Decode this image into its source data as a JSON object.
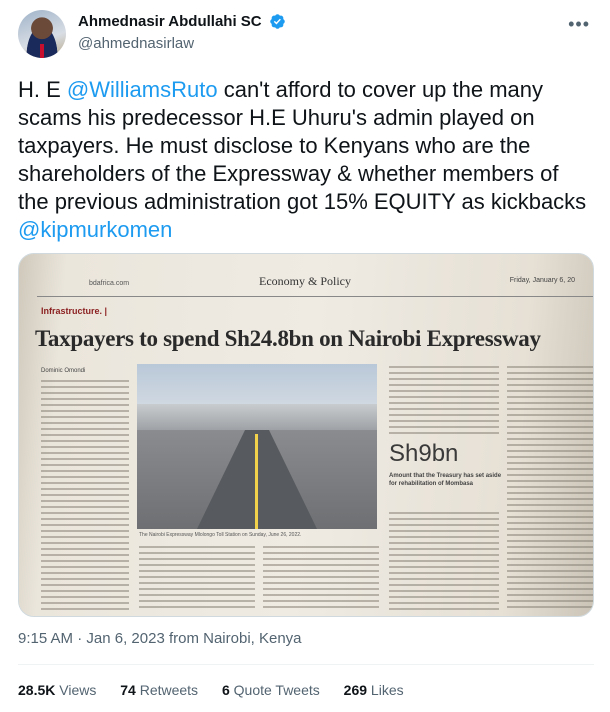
{
  "author": {
    "display_name": "Ahmednasir Abdullahi SC",
    "handle": "@ahmednasirlaw",
    "verified": true,
    "verified_color": "#1d9bf0"
  },
  "tweet": {
    "segments": [
      {
        "text": "H. E ",
        "type": "text"
      },
      {
        "text": "@WilliamsRuto",
        "type": "mention"
      },
      {
        "text": " can't afford to cover up the many scams his predecessor H.E Uhuru's admin played on taxpayers. He must disclose to Kenyans who are the shareholders of the Expressway & whether members of the previous administration got 15% EQUITY as kickbacks ",
        "type": "text"
      },
      {
        "text": "@kipmurkomen",
        "type": "mention"
      }
    ]
  },
  "media": {
    "site": "bdafrica.com",
    "section": "Economy & Policy",
    "date": "Friday, January 6, 20",
    "kicker": "Infrastructure. |",
    "headline": "Taxpayers to spend Sh24.8bn on Nairobi Expressway",
    "byline": "Dominic Omondi",
    "photo_caption": "The Nairobi Expressway Mlolongo Toll Station on Sunday, June 26, 2022.",
    "pull_figure": "Sh9bn",
    "pull_description": "Amount that the Treasury has set aside for rehabilitation of Mombasa"
  },
  "meta": {
    "time": "9:15 AM",
    "date": "Jan 6, 2023",
    "source": "from Nairobi, Kenya"
  },
  "stats": {
    "views_count": "28.5K",
    "views_label": "Views",
    "retweets_count": "74",
    "retweets_label": "Retweets",
    "quotes_count": "6",
    "quotes_label": "Quote Tweets",
    "likes_count": "269",
    "likes_label": "Likes"
  },
  "icons": {
    "more": "more-options-icon",
    "verified": "verified-badge-icon"
  },
  "colors": {
    "accent": "#1d9bf0",
    "secondary_text": "#536471",
    "primary_text": "#0f1419"
  }
}
